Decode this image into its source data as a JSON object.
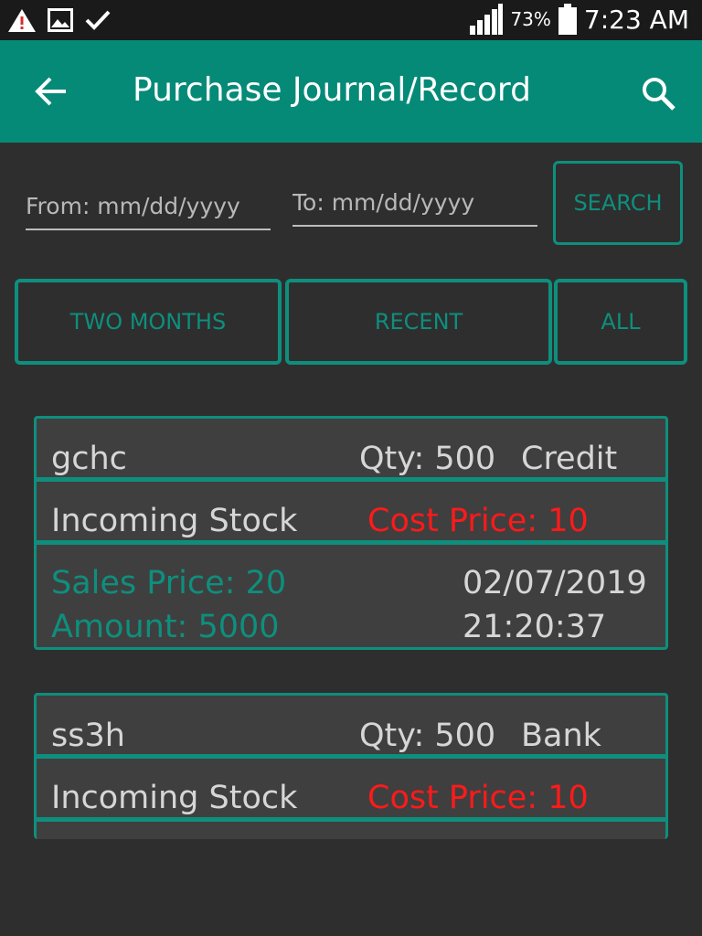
{
  "status_bar": {
    "battery_percent": "73%",
    "time": "7:23 AM"
  },
  "app_bar": {
    "title": "Purchase Journal/Record"
  },
  "date_filter": {
    "from_placeholder": "From: mm/dd/yyyy",
    "to_placeholder": "To: mm/dd/yyyy",
    "search_label": "SEARCH"
  },
  "quick_filters": [
    {
      "label": "TWO MONTHS"
    },
    {
      "label": "RECENT"
    },
    {
      "label": "ALL"
    }
  ],
  "records": [
    {
      "name": "gchc",
      "qty": "Qty: 500",
      "payment": "Credit",
      "type": "Incoming Stock",
      "cost_price": "Cost Price: 10",
      "sales_price": "Sales Price: 20",
      "amount": "Amount: 5000",
      "date": "02/07/2019",
      "time": "21:20:37"
    },
    {
      "name": "ss3h",
      "qty": "Qty: 500",
      "payment": "Bank",
      "type": "Incoming Stock",
      "cost_price": "Cost Price: 10"
    }
  ],
  "colors": {
    "accent": "#058a78",
    "border_teal": "#0e8f7d",
    "background": "#2e2e2e",
    "card": "#3f3f3f",
    "cost_red": "#ff1a1a"
  },
  "icons": {
    "status_left": [
      "warning-icon",
      "image-icon",
      "check-icon"
    ],
    "status_right": [
      "signal-icon",
      "battery-icon"
    ],
    "app_bar": [
      "back-arrow-icon",
      "search-icon"
    ]
  }
}
